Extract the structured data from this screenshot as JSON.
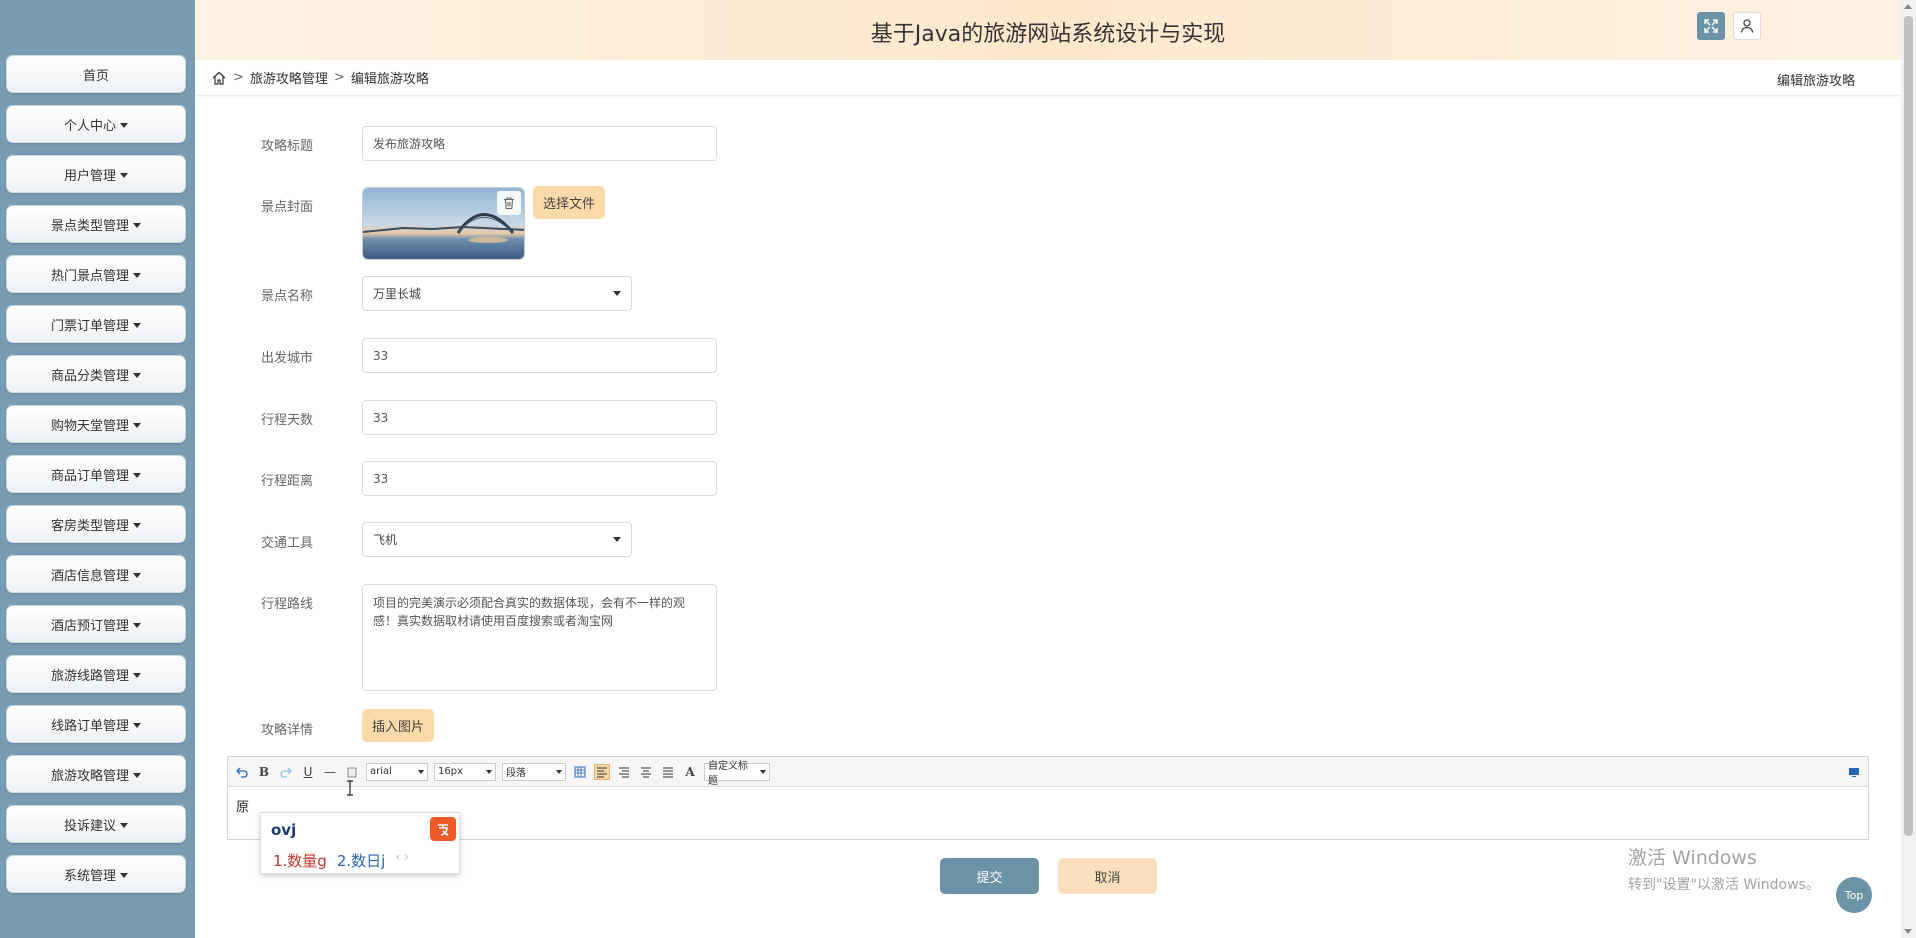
{
  "header": {
    "title": "基于Java的旅游网站系统设计与实现"
  },
  "sidebar": {
    "items": [
      {
        "label": "首页",
        "dropdown": false
      },
      {
        "label": "个人中心",
        "dropdown": true
      },
      {
        "label": "用户管理",
        "dropdown": true
      },
      {
        "label": "景点类型管理",
        "dropdown": true
      },
      {
        "label": "热门景点管理",
        "dropdown": true
      },
      {
        "label": "门票订单管理",
        "dropdown": true
      },
      {
        "label": "商品分类管理",
        "dropdown": true
      },
      {
        "label": "购物天堂管理",
        "dropdown": true
      },
      {
        "label": "商品订单管理",
        "dropdown": true
      },
      {
        "label": "客房类型管理",
        "dropdown": true
      },
      {
        "label": "酒店信息管理",
        "dropdown": true
      },
      {
        "label": "酒店预订管理",
        "dropdown": true
      },
      {
        "label": "旅游线路管理",
        "dropdown": true
      },
      {
        "label": "线路订单管理",
        "dropdown": true
      },
      {
        "label": "旅游攻略管理",
        "dropdown": true
      },
      {
        "label": "投诉建议",
        "dropdown": true
      },
      {
        "label": "系统管理",
        "dropdown": true
      }
    ]
  },
  "breadcrumb": {
    "sep": ">",
    "level1": "旅游攻略管理",
    "level2": "编辑旅游攻略",
    "right": "编辑旅游攻略"
  },
  "form": {
    "title_label": "攻略标题",
    "title_value": "发布旅游攻略",
    "cover_label": "景点封面",
    "choose_file": "选择文件",
    "spot_label": "景点名称",
    "spot_value": "万里长城",
    "city_label": "出发城市",
    "city_value": "33",
    "days_label": "行程天数",
    "days_value": "33",
    "distance_label": "行程距离",
    "distance_value": "33",
    "transport_label": "交通工具",
    "transport_value": "飞机",
    "route_label": "行程路线",
    "route_value": "项目的完美演示必须配合真实的数据体现，会有不一样的观感！真实数据取材请使用百度搜索或者淘宝网",
    "detail_label": "攻略详情",
    "insert_image": "插入图片"
  },
  "editor": {
    "font_family": "arial",
    "font_size": "16px",
    "paragraph": "段落",
    "custom_title": "自定义标题",
    "content": "原"
  },
  "ime": {
    "input": "ovj",
    "cand1": "1.数量g",
    "cand2": "2.数日j",
    "arrows": "‹ ›"
  },
  "actions": {
    "submit": "提交",
    "cancel": "取消"
  },
  "watermark": {
    "line1": "激活 Windows",
    "line2": "转到\"设置\"以激活 Windows。"
  },
  "top_button": "Top",
  "colors": {
    "sidebar": "#7a9cb3",
    "primary": "#6c92a6",
    "accent": "#fbd9a9"
  }
}
